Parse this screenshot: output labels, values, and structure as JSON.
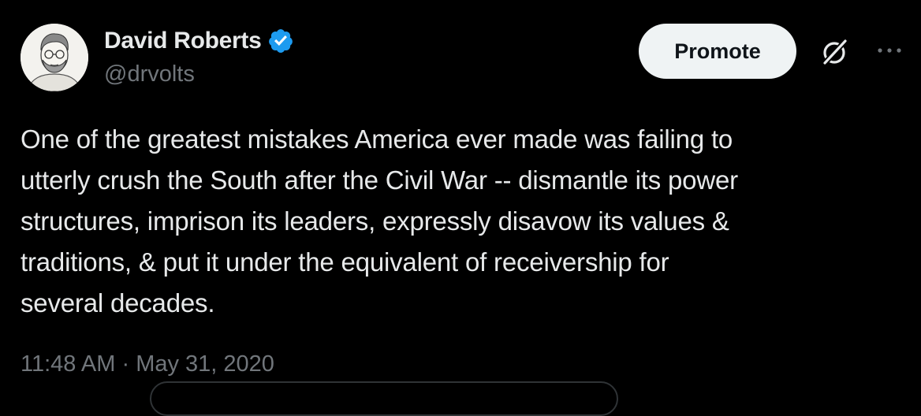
{
  "author": {
    "display_name": "David Roberts",
    "handle": "@drvolts",
    "verified": true,
    "verified_color": "#1d9bf0"
  },
  "actions": {
    "promote_label": "Promote",
    "grok_icon": "grok-icon",
    "more_icon": "more-horizontal-icon"
  },
  "tweet": {
    "text": "One of the greatest mistakes America ever made was failing to\nutterly crush the South after the Civil War -- dismantle its power\nstructures, imprison its leaders, expressly disavow its values &\ntraditions, & put it under the equivalent of receivership for\nseveral decades.",
    "time": "11:48 AM",
    "separator": "·",
    "date": "May 31, 2020"
  },
  "colors": {
    "background": "#000000",
    "text": "#e7e9ea",
    "secondary": "#71767b",
    "button_bg": "#eff3f4"
  }
}
